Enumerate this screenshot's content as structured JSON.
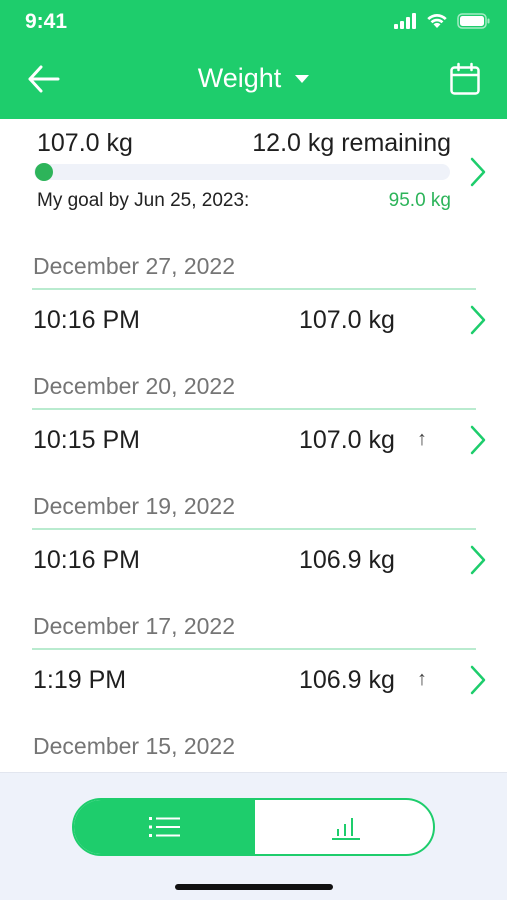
{
  "status_bar": {
    "time": "9:41"
  },
  "nav": {
    "title": "Weight",
    "icons": [
      "back-arrow-icon",
      "dropdown-caret-icon",
      "calendar-icon"
    ]
  },
  "goal": {
    "current_weight": "107.0 kg",
    "remaining": "12.0 kg remaining",
    "goal_by_label": "My goal by  Jun 25, 2023:",
    "goal_weight": "95.0 kg",
    "progress_fraction": 0.0
  },
  "entries": [
    {
      "date": "December 27, 2022",
      "time": "10:16 PM",
      "weight": "107.0 kg",
      "trend": ""
    },
    {
      "date": "December 20, 2022",
      "time": "10:15 PM",
      "weight": "107.0 kg",
      "trend": "↑"
    },
    {
      "date": "December 19, 2022",
      "time": "10:16 PM",
      "weight": "106.9 kg",
      "trend": ""
    },
    {
      "date": "December 17, 2022",
      "time": "1:19 PM",
      "weight": "106.9 kg",
      "trend": "↑"
    },
    {
      "date": "December 15, 2022"
    }
  ],
  "bottom_toggle": {
    "active": "list",
    "icons": [
      "list-icon",
      "bar-chart-icon"
    ]
  },
  "colors": {
    "accent": "#1ecd6c",
    "goal_green": "#2db45a",
    "divider": "#b9ebcf",
    "muted_text": "#757575"
  }
}
